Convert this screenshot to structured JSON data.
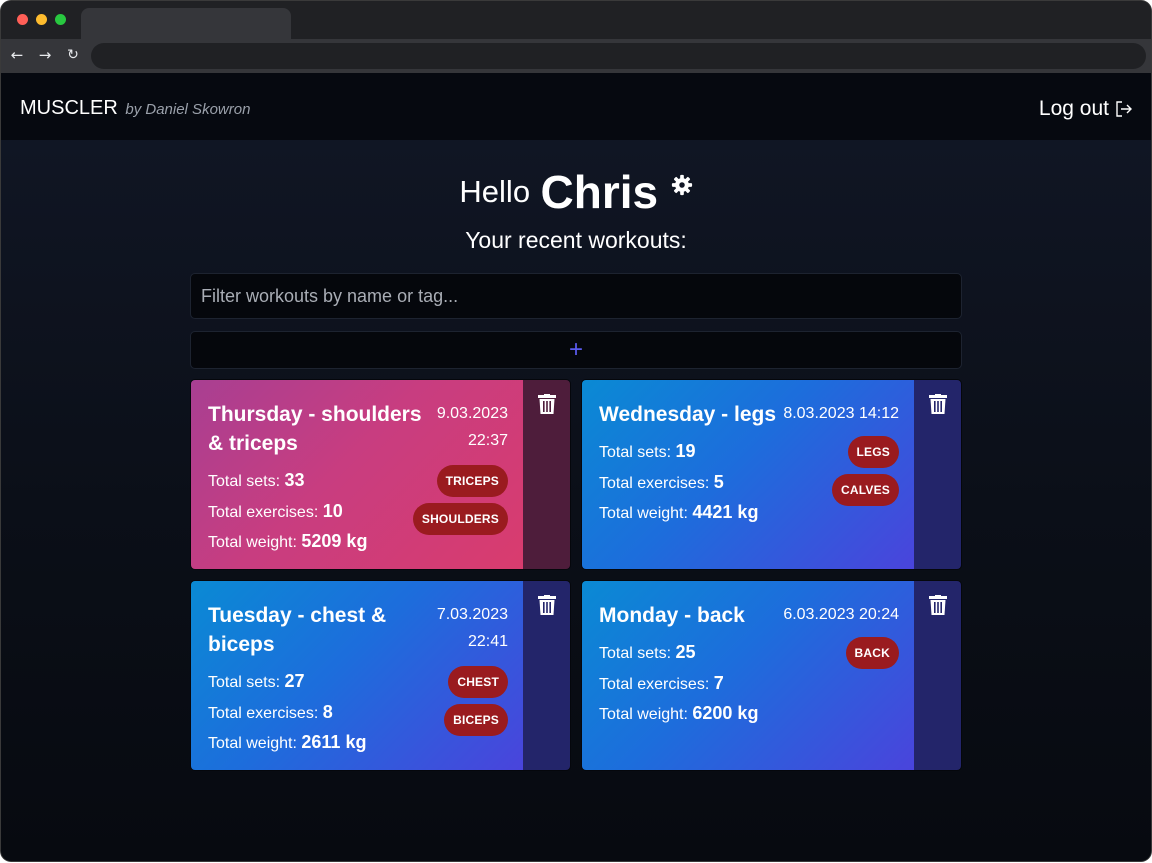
{
  "navbar": {
    "brand": "MUSCLER",
    "brand_sub": "by Daniel Skowron",
    "logout_label": "Log out"
  },
  "greeting": {
    "hello": "Hello",
    "username": "Chris",
    "subtitle": "Your recent workouts:"
  },
  "filter": {
    "placeholder": "Filter workouts by name or tag..."
  },
  "add_button": {
    "label": "+"
  },
  "labels": {
    "total_sets": "Total sets:",
    "total_exercises": "Total exercises:",
    "total_weight": "Total weight:"
  },
  "workouts": [
    {
      "title": "Thursday - shoulders & triceps",
      "date": "9.03.2023",
      "time": "22:37",
      "total_sets": "33",
      "total_exercises": "10",
      "total_weight": "5209 kg",
      "tags": [
        "TRICEPS",
        "SHOULDERS"
      ]
    },
    {
      "title": "Wednesday - legs",
      "date": "8.03.2023",
      "time": "14:12",
      "total_sets": "19",
      "total_exercises": "5",
      "total_weight": "4421 kg",
      "tags": [
        "LEGS",
        "CALVES"
      ]
    },
    {
      "title": "Tuesday - chest & biceps",
      "date": "7.03.2023",
      "time": "22:41",
      "total_sets": "27",
      "total_exercises": "8",
      "total_weight": "2611 kg",
      "tags": [
        "CHEST",
        "BICEPS"
      ]
    },
    {
      "title": "Monday - back",
      "date": "6.03.2023",
      "time": "20:24",
      "total_sets": "25",
      "total_exercises": "7",
      "total_weight": "6200 kg",
      "tags": [
        "BACK"
      ]
    }
  ],
  "colors": {
    "accent": "#5b5bf0",
    "tag_bg": "#9a1b1f",
    "card_pink_start": "#a83f92",
    "card_blue_start": "#0a8ad4",
    "card_blue_end": "#4a44dc"
  },
  "icons": {
    "settings": "gear-icon",
    "logout": "logout-icon",
    "delete": "trash-icon"
  }
}
